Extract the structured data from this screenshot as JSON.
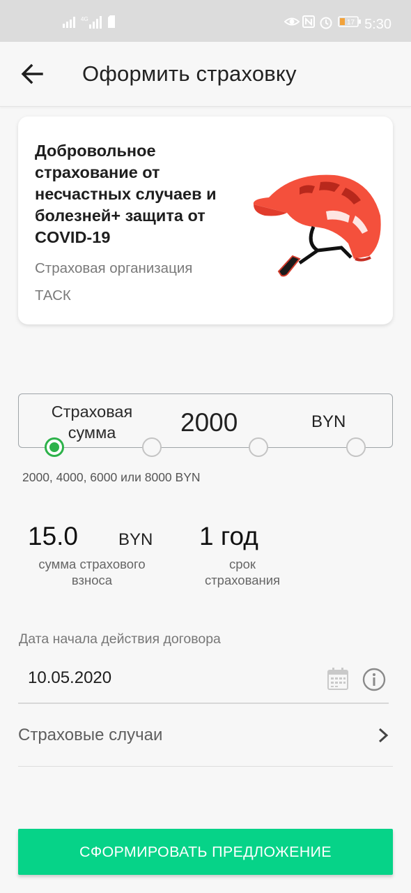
{
  "status_bar": {
    "time": "5:30",
    "battery": "17"
  },
  "app_bar": {
    "title": "Оформить страховку"
  },
  "product_card": {
    "title": "Добровольное страхование от несчастных случаев и болезней+ защита от COVID-19",
    "insurer_label": "Страховая организация",
    "insurer_name": "ТАСК",
    "image": "helmet"
  },
  "sum_selector": {
    "label": "Страховая сумма",
    "value": "2000",
    "currency": "BYN",
    "hint": "2000, 4000, 6000 или 8000 BYN",
    "options": [
      "2000",
      "4000",
      "6000",
      "8000"
    ],
    "selected_index": 0,
    "accent_color": "#2db24a"
  },
  "premium": {
    "value": "15.0",
    "currency": "BYN",
    "caption": "сумма страхового взноса"
  },
  "term": {
    "value": "1 год",
    "caption": "срок страхования"
  },
  "start_date": {
    "label": "Дата начала действия договора",
    "value": "10.05.2020"
  },
  "insured_events": {
    "label": "Страховые случаи"
  },
  "submit": {
    "label": "СФОРМИРОВАТЬ ПРЕДЛОЖЕНИЕ",
    "color": "#06d388"
  }
}
